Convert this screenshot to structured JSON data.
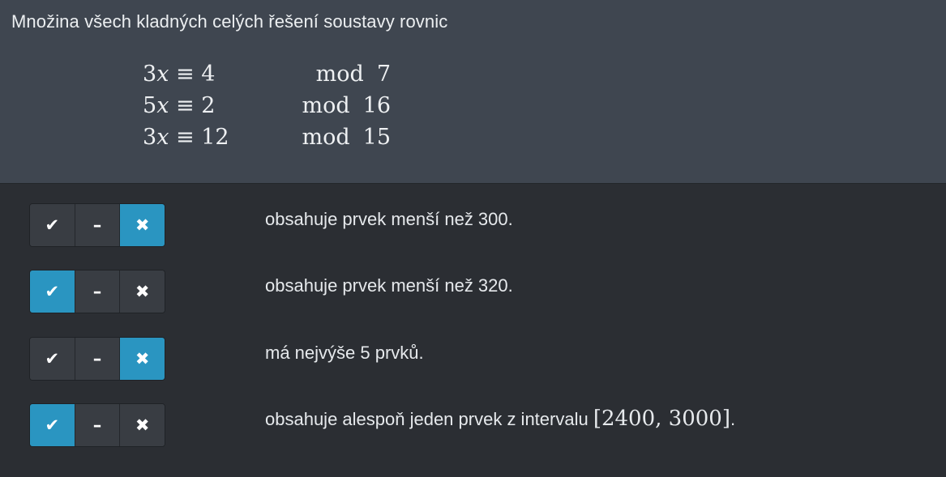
{
  "question": {
    "title": "Množina všech kladných celých řešení soustavy rovnic",
    "equations": [
      {
        "coef": "3",
        "var": "x",
        "equiv": "≡",
        "rhs": "4",
        "mod_word": "mod",
        "modulus": "7"
      },
      {
        "coef": "5",
        "var": "x",
        "equiv": "≡",
        "rhs": "2",
        "mod_word": "mod",
        "modulus": "16"
      },
      {
        "coef": "3",
        "var": "x",
        "equiv": "≡",
        "rhs": "12",
        "mod_word": "mod",
        "modulus": "15"
      }
    ]
  },
  "button_icons": {
    "true": "✔",
    "neutral": "–",
    "false": "✖"
  },
  "statements": [
    {
      "text": "obsahuje prvek menší než 300.",
      "math": "",
      "suffix": "",
      "selected": "false"
    },
    {
      "text": "obsahuje prvek menší než 320.",
      "math": "",
      "suffix": "",
      "selected": "true"
    },
    {
      "text": "má nejvýše 5 prvků.",
      "math": "",
      "suffix": "",
      "selected": "false"
    },
    {
      "text": "obsahuje alespoň jeden prvek z intervalu ",
      "math": "[2400, 3000]",
      "suffix": ".",
      "selected": "true"
    }
  ],
  "colors": {
    "active": "#2a95c1",
    "header_bg": "#3f4650",
    "body_bg": "#2b2e33"
  }
}
